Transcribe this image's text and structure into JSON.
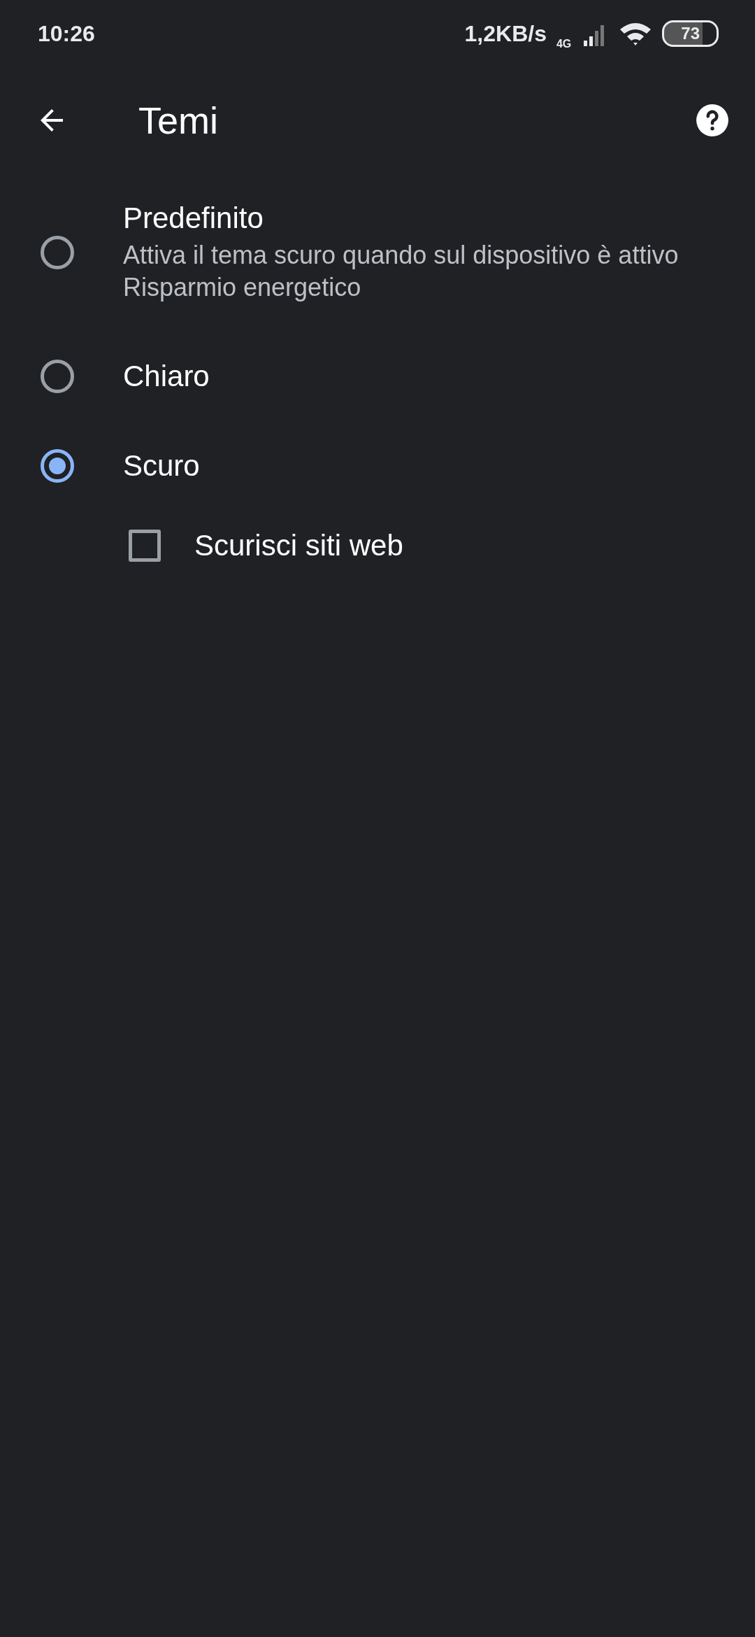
{
  "status_bar": {
    "time": "10:26",
    "speed": "1,2KB/s",
    "network": "4G",
    "battery": "73"
  },
  "app_bar": {
    "title": "Temi"
  },
  "options": [
    {
      "title": "Predefinito",
      "subtitle": "Attiva il tema scuro quando sul dispositivo è attivo Risparmio energetico",
      "selected": false
    },
    {
      "title": "Chiaro",
      "selected": false
    },
    {
      "title": "Scuro",
      "selected": true
    }
  ],
  "darken_websites": {
    "label": "Scurisci siti web",
    "checked": false
  }
}
